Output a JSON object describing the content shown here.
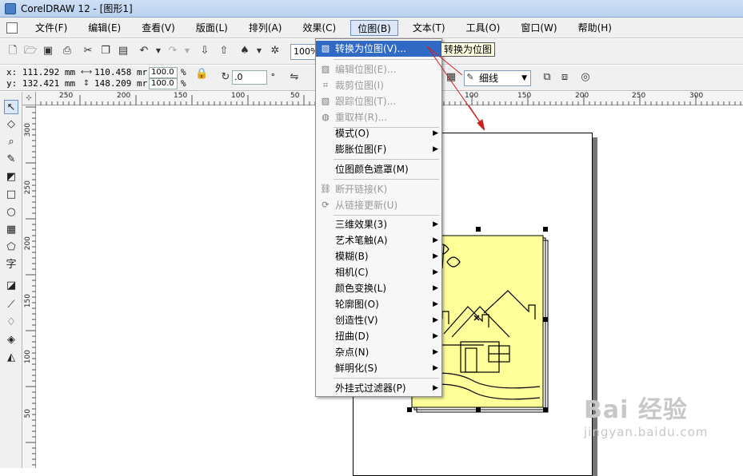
{
  "window": {
    "title": "CorelDRAW 12 - [图形1]"
  },
  "menubar": {
    "items": [
      "文件(F)",
      "编辑(E)",
      "查看(V)",
      "版面(L)",
      "排列(A)",
      "效果(C)",
      "位图(B)",
      "文本(T)",
      "工具(O)",
      "窗口(W)",
      "帮助(H)"
    ],
    "active_index": 6
  },
  "toolbar": {
    "zoom": "100%"
  },
  "propertybar": {
    "x": "x: 111.292 mm",
    "y": "y: 132.421 mm",
    "width": "110.458 mr",
    "height": "148.209 mr",
    "scale_w": "100.0",
    "scale_h": "100.0",
    "percent": "%",
    "rotation": ".0",
    "degree": "°",
    "line_style": "细线"
  },
  "ruler": {
    "h_labels": [
      "250",
      "200",
      "150",
      "100",
      "50",
      "100",
      "150",
      "200",
      "250",
      "300"
    ],
    "v_labels": [
      "300",
      "250",
      "200",
      "150",
      "100",
      "50"
    ]
  },
  "bitmap_menu": {
    "items": [
      {
        "label": "转换为位图(V)...",
        "state": "highlighted",
        "icon": "convert-bitmap-icon"
      },
      {
        "label": "编辑位图(E)...",
        "state": "disabled",
        "icon": "edit-bitmap-icon"
      },
      {
        "label": "裁剪位图(I)",
        "state": "disabled",
        "icon": "crop-bitmap-icon"
      },
      {
        "label": "跟踪位图(T)...",
        "state": "disabled",
        "icon": "trace-bitmap-icon"
      },
      {
        "label": "重取样(R)...",
        "state": "disabled",
        "icon": "resample-icon"
      },
      {
        "label": "模式(O)",
        "state": "submenu"
      },
      {
        "label": "膨胀位图(F)",
        "state": "submenu"
      },
      {
        "label": "位图颜色遮罩(M)",
        "state": "normal"
      },
      {
        "label": "断开链接(K)",
        "state": "disabled",
        "icon": "break-link-icon"
      },
      {
        "label": "从链接更新(U)",
        "state": "disabled",
        "icon": "update-link-icon"
      },
      {
        "label": "三维效果(3)",
        "state": "submenu"
      },
      {
        "label": "艺术笔触(A)",
        "state": "submenu"
      },
      {
        "label": "模糊(B)",
        "state": "submenu"
      },
      {
        "label": "相机(C)",
        "state": "submenu"
      },
      {
        "label": "颜色变换(L)",
        "state": "submenu"
      },
      {
        "label": "轮廓图(O)",
        "state": "submenu"
      },
      {
        "label": "创造性(V)",
        "state": "submenu"
      },
      {
        "label": "扭曲(D)",
        "state": "submenu"
      },
      {
        "label": "杂点(N)",
        "state": "submenu"
      },
      {
        "label": "鲜明化(S)",
        "state": "submenu"
      },
      {
        "label": "外挂式过滤器(P)",
        "state": "submenu"
      }
    ]
  },
  "tooltip": {
    "text": "转换为位图"
  },
  "watermark": {
    "brand": "Bai 经验",
    "site": "jingyan.baidu.com"
  },
  "colors": {
    "accent": "#316ac5",
    "illustration_fill": "#ffff99",
    "arrow": "#cc2222"
  }
}
